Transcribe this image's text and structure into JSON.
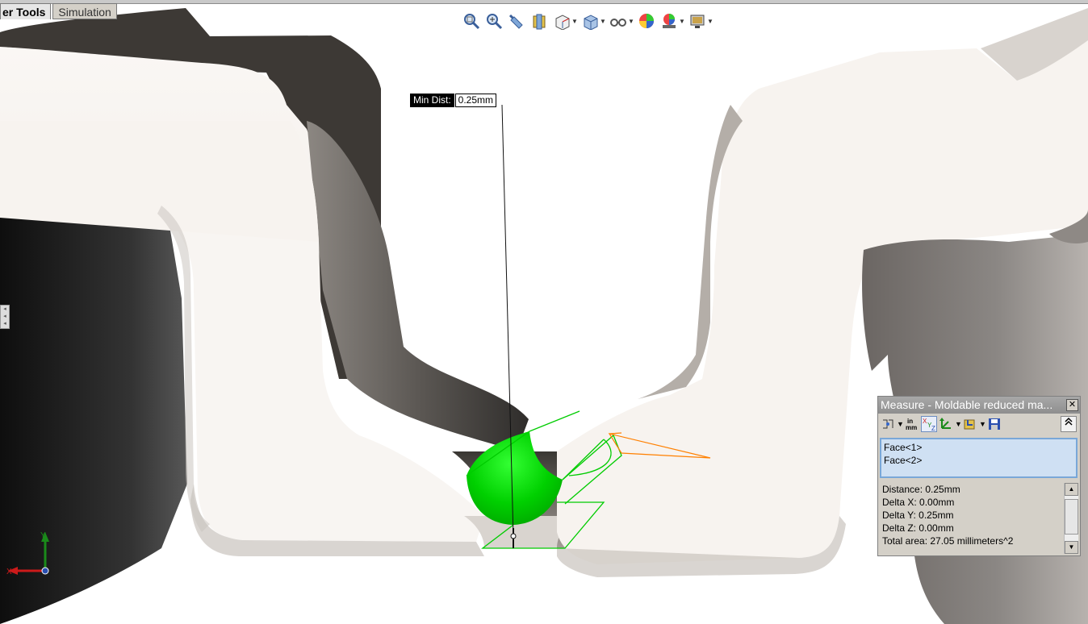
{
  "tabs": {
    "active": "er Tools",
    "inactive": "Simulation"
  },
  "toolbar": {
    "icons": [
      "zoom-to-fit-icon",
      "zoom-to-area-icon",
      "previous-view-icon",
      "section-view-icon",
      "view-orientation-icon",
      "display-style-icon",
      "hide-show-items-icon",
      "edit-appearance-icon",
      "apply-scene-icon",
      "view-settings-icon"
    ]
  },
  "annotation": {
    "label": "Min Dist:",
    "value": "0.25mm"
  },
  "measure": {
    "title": "Measure - Moldable reduced ma...",
    "close": "✕",
    "selections": [
      "Face<1>",
      "Face<2>"
    ],
    "results": [
      "Distance: 0.25mm",
      "Delta X: 0.00mm",
      "Delta Y: 0.25mm",
      "Delta Z: 0.00mm",
      "Total area: 27.05 millimeters^2"
    ],
    "units_icon_label": "in mm"
  },
  "triad": {
    "x_label": "X",
    "y_label": "Y"
  },
  "colors": {
    "highlight": "#00dd00",
    "sketch": "#ff8000",
    "panel": "#d4d0c8",
    "selection_bg": "#cfe0f3"
  }
}
